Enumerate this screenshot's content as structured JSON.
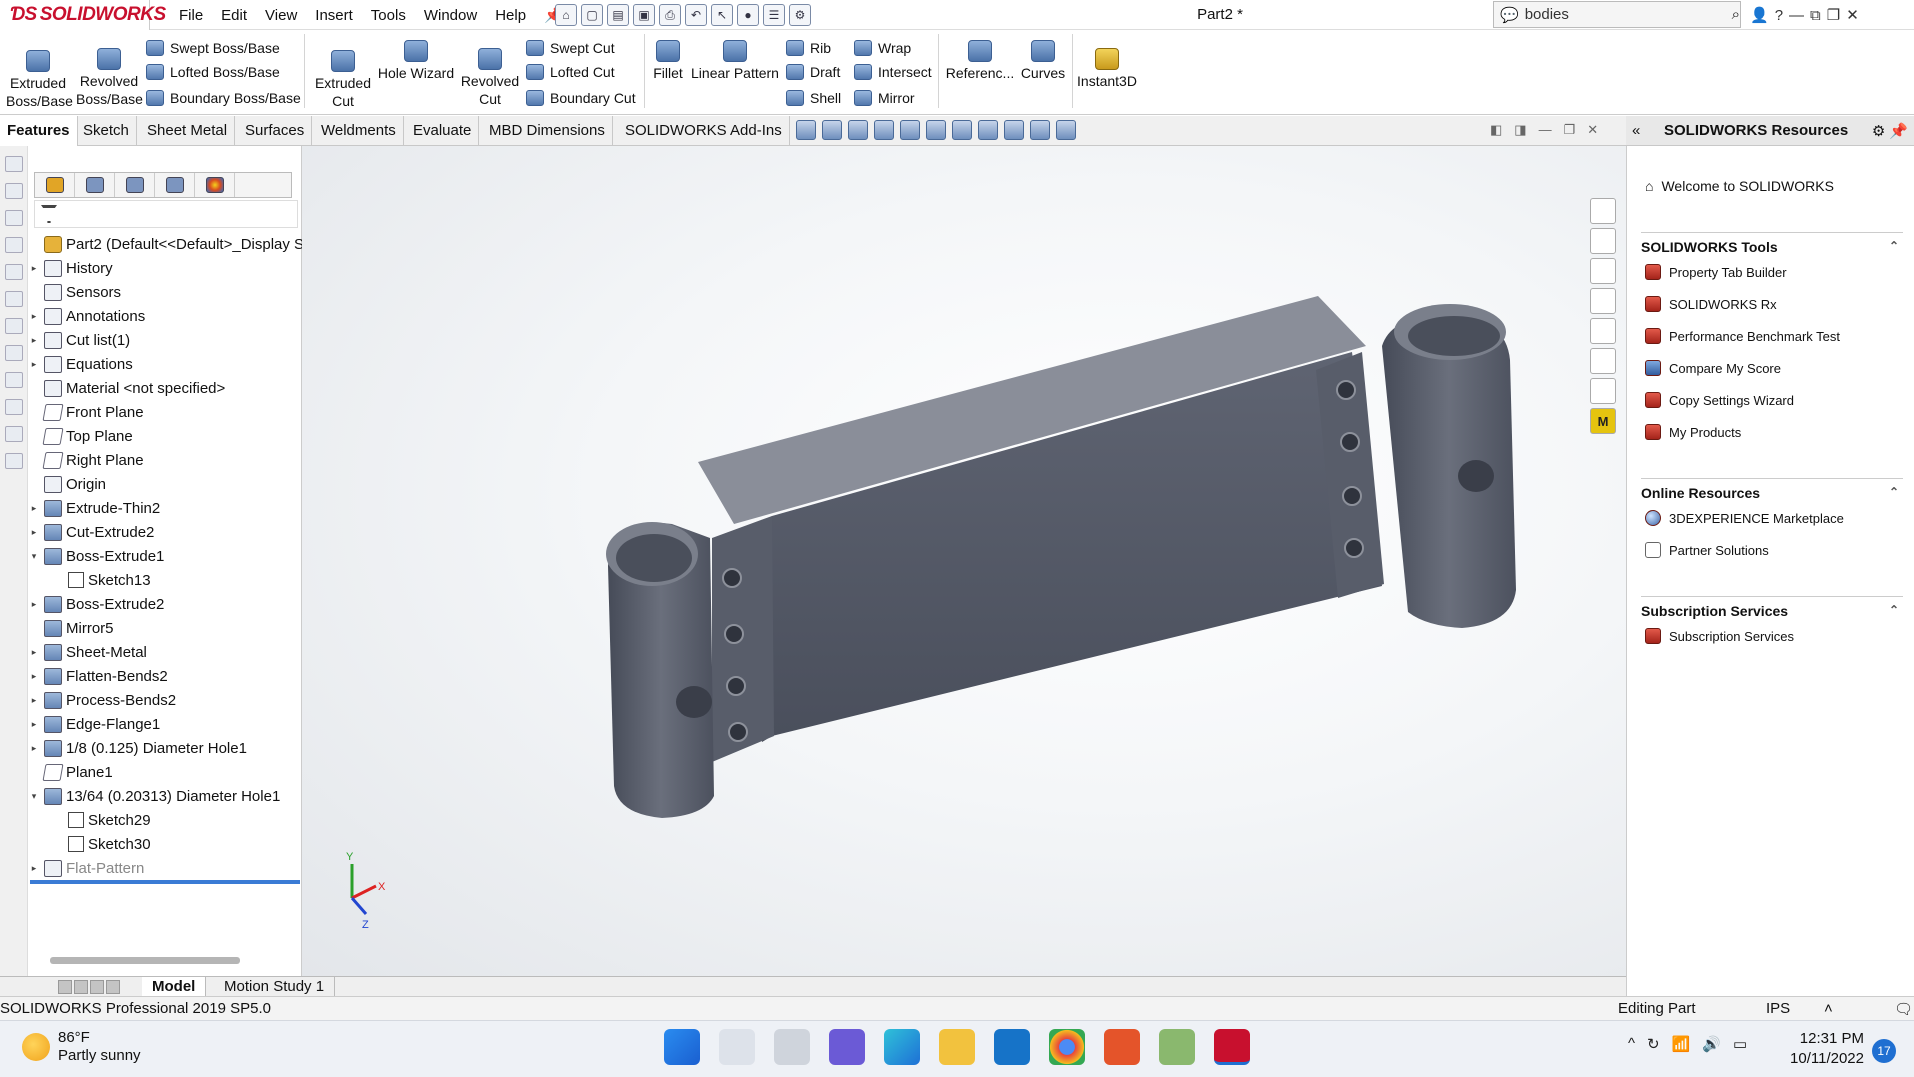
{
  "app": {
    "logo": "SOLIDWORKS",
    "doc_title": "Part2 *"
  },
  "menu": [
    "File",
    "Edit",
    "View",
    "Insert",
    "Tools",
    "Window",
    "Help"
  ],
  "search": {
    "value": "bodies"
  },
  "ribbon": {
    "extruded_boss": "Extruded Boss/Base",
    "revolved_boss": "Revolved Boss/Base",
    "swept_boss": "Swept Boss/Base",
    "lofted_boss": "Lofted Boss/Base",
    "boundary_boss": "Boundary Boss/Base",
    "extruded_cut": "Extruded Cut",
    "hole_wizard": "Hole Wizard",
    "revolved_cut": "Revolved Cut",
    "swept_cut": "Swept Cut",
    "lofted_cut": "Lofted Cut",
    "boundary_cut": "Boundary Cut",
    "fillet": "Fillet",
    "linear_pattern": "Linear Pattern",
    "rib": "Rib",
    "draft": "Draft",
    "shell": "Shell",
    "wrap": "Wrap",
    "intersect": "Intersect",
    "mirror": "Mirror",
    "reference": "Referenc...",
    "curves": "Curves",
    "instant3d": "Instant3D"
  },
  "tabs": [
    "Features",
    "Sketch",
    "Sheet Metal",
    "Surfaces",
    "Weldments",
    "Evaluate",
    "MBD Dimensions",
    "SOLIDWORKS Add-Ins"
  ],
  "resources_title": "SOLIDWORKS Resources",
  "tree": [
    {
      "label": "Part2  (Default<<Default>_Display S",
      "icon": "part",
      "arrow": ""
    },
    {
      "label": "History",
      "icon": "gen",
      "arrow": "▸"
    },
    {
      "label": "Sensors",
      "icon": "gen",
      "arrow": ""
    },
    {
      "label": "Annotations",
      "icon": "gen",
      "arrow": "▸"
    },
    {
      "label": "Cut list(1)",
      "icon": "gen",
      "arrow": "▸"
    },
    {
      "label": "Equations",
      "icon": "gen",
      "arrow": "▸"
    },
    {
      "label": "Material <not specified>",
      "icon": "gen",
      "arrow": ""
    },
    {
      "label": "Front Plane",
      "icon": "pl",
      "arrow": ""
    },
    {
      "label": "Top Plane",
      "icon": "pl",
      "arrow": ""
    },
    {
      "label": "Right Plane",
      "icon": "pl",
      "arrow": ""
    },
    {
      "label": "Origin",
      "icon": "gen",
      "arrow": ""
    },
    {
      "label": "Extrude-Thin2",
      "icon": "feat",
      "arrow": "▸"
    },
    {
      "label": "Cut-Extrude2",
      "icon": "feat",
      "arrow": "▸"
    },
    {
      "label": "Boss-Extrude1",
      "icon": "feat",
      "arrow": "▾"
    },
    {
      "label": "Sketch13",
      "icon": "sk",
      "arrow": "",
      "indent": 1
    },
    {
      "label": "Boss-Extrude2",
      "icon": "feat",
      "arrow": "▸"
    },
    {
      "label": "Mirror5",
      "icon": "feat",
      "arrow": ""
    },
    {
      "label": "Sheet-Metal",
      "icon": "feat",
      "arrow": "▸"
    },
    {
      "label": "Flatten-Bends2",
      "icon": "feat",
      "arrow": "▸"
    },
    {
      "label": "Process-Bends2",
      "icon": "feat",
      "arrow": "▸"
    },
    {
      "label": "Edge-Flange1",
      "icon": "feat",
      "arrow": "▸"
    },
    {
      "label": "1/8 (0.125) Diameter Hole1",
      "icon": "feat",
      "arrow": "▸"
    },
    {
      "label": "Plane1",
      "icon": "pl",
      "arrow": ""
    },
    {
      "label": "13/64 (0.20313) Diameter Hole1",
      "icon": "feat",
      "arrow": "▾"
    },
    {
      "label": "Sketch29",
      "icon": "sk",
      "arrow": "",
      "indent": 1
    },
    {
      "label": "Sketch30",
      "icon": "sk",
      "arrow": "",
      "indent": 1
    },
    {
      "label": "Flat-Pattern",
      "icon": "gen",
      "arrow": "▸",
      "dim": true
    }
  ],
  "resources": {
    "welcome": "Welcome to SOLIDWORKS",
    "tools_title": "SOLIDWORKS Tools",
    "tools": [
      "Property Tab Builder",
      "SOLIDWORKS Rx",
      "Performance Benchmark Test",
      "Compare My Score",
      "Copy Settings Wizard",
      "My Products"
    ],
    "online_title": "Online Resources",
    "online": [
      "3DEXPERIENCE Marketplace",
      "Partner Solutions"
    ],
    "subs_title": "Subscription Services",
    "subs": [
      "Subscription Services"
    ]
  },
  "bottom_tabs": [
    "Model",
    "Motion Study 1"
  ],
  "status": {
    "left": "SOLIDWORKS Professional 2019 SP5.0",
    "mode": "Editing Part",
    "units": "IPS"
  },
  "taskbar": {
    "temp": "86°F",
    "weather": "Partly sunny",
    "time": "12:31 PM",
    "date": "10/11/2022",
    "notifications": "17"
  },
  "triad": {
    "x": "X",
    "y": "Y",
    "z": "Z"
  }
}
